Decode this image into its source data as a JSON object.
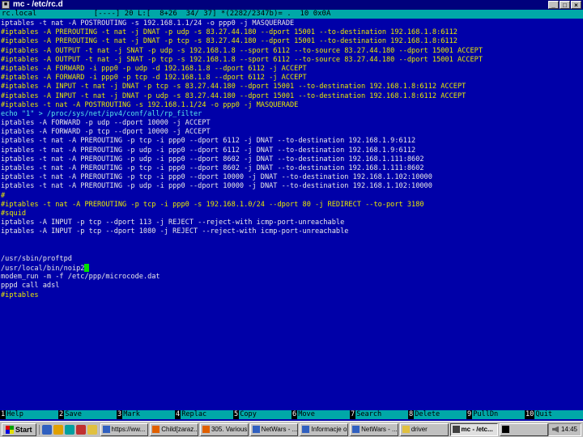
{
  "window": {
    "title": "mc - /etc/rc.d",
    "controls": [
      "_",
      "□",
      "×"
    ]
  },
  "status_line": "rc.local             [----] 20 L:[  8+26  34/ 37] *(2282/2347b)= .  10 0x0A",
  "editor": {
    "lines": [
      {
        "text": "iptables -t nat -A POSTROUTING -s 192.168.1.1/24 -o ppp0 -j MASQUERADE",
        "color": "white"
      },
      {
        "text": "#iptables -A PREROUTING -t nat -j DNAT -p udp -s 83.27.44.180 --dport 15001 --to-destination 192.168.1.8:6112",
        "color": "yellow"
      },
      {
        "text": "#iptables -A PREROUTING -t nat -j DNAT -p tcp -s 83.27.44.180 --dport 15001 --to-destination 192.168.1.8:6112",
        "color": "yellow"
      },
      {
        "text": "#iptables -A OUTPUT -t nat -j SNAT -p udp -s 192.168.1.8 --sport 6112 --to-source 83.27.44.180 --dport 15001 ACCEPT",
        "color": "yellow"
      },
      {
        "text": "#iptables -A OUTPUT -t nat -j SNAT -p tcp -s 192.168.1.8 --sport 6112 --to-source 83.27.44.180 --dport 15001 ACCEPT",
        "color": "yellow"
      },
      {
        "text": "#iptables -A FORWARD -i ppp0 -p udp -d 192.168.1.8 --dport 6112 -j ACCEPT",
        "color": "yellow"
      },
      {
        "text": "#iptables -A FORWARD -i ppp0 -p tcp -d 192.168.1.8 --dport 6112 -j ACCEPT",
        "color": "yellow"
      },
      {
        "text": "#iptables -A INPUT -t nat -j DNAT -p tcp -s 83.27.44.180 --dport 15001 --to-destination 192.168.1.8:6112 ACCEPT",
        "color": "yellow"
      },
      {
        "text": "#iptables -A INPUT -t nat -j DNAT -p udp -s 83.27.44.180 --dport 15001 --to-destination 192.168.1.8:6112 ACCEPT",
        "color": "yellow"
      },
      {
        "text": "#iptables -t nat -A POSTROUTING -s 192.168.1.1/24 -o ppp0 -j MASQUERADE",
        "color": "yellow"
      },
      {
        "text": "echo \"1\" > /proc/sys/net/ipv4/conf/all/rp_filter",
        "color": "cyan"
      },
      {
        "text": "iptables -A FORWARD -p udp --dport 10000 -j ACCEPT",
        "color": "white"
      },
      {
        "text": "iptables -A FORWARD -p tcp --dport 10000 -j ACCEPT",
        "color": "white"
      },
      {
        "text": "iptables -t nat -A PREROUTING -p tcp -i ppp0 --dport 6112 -j DNAT --to-destination 192.168.1.9:6112",
        "color": "white"
      },
      {
        "text": "iptables -t nat -A PREROUTING -p udp -i ppp0 --dport 6112 -j DNAT --to-destination 192.168.1.9:6112",
        "color": "white"
      },
      {
        "text": "iptables -t nat -A PREROUTING -p udp -i ppp0 --dport 8602 -j DNAT --to-destination 192.168.1.111:8602",
        "color": "white"
      },
      {
        "text": "iptables -t nat -A PREROUTING -p tcp -i ppp0 --dport 8602 -j DNAT --to-destination 192.168.1.111:8602",
        "color": "white"
      },
      {
        "text": "iptables -t nat -A PREROUTING -p tcp -i ppp0 --dport 10000 -j DNAT --to-destination 192.168.1.102:10000",
        "color": "white"
      },
      {
        "text": "iptables -t nat -A PREROUTING -p udp -i ppp0 --dport 10000 -j DNAT --to-destination 192.168.1.102:10000",
        "color": "white"
      },
      {
        "text": "#",
        "color": "yellow"
      },
      {
        "text": "#iptables -t nat -A PREROUTING -p tcp -i ppp0 -s 192.168.1.0/24 --dport 80 -j REDIRECT --to-port 3180",
        "color": "yellow"
      },
      {
        "text": "#squid",
        "color": "yellow"
      },
      {
        "text": "iptables -A INPUT -p tcp --dport 113 -j REJECT --reject-with icmp-port-unreachable",
        "color": "white"
      },
      {
        "text": "iptables -A INPUT -p tcp --dport 1080 -j REJECT --reject-with icmp-port-unreachable",
        "color": "white"
      },
      {
        "text": "",
        "color": "white"
      },
      {
        "text": "",
        "color": "white"
      },
      {
        "text": "/usr/sbin/proftpd",
        "color": "white"
      },
      {
        "text": "/usr/local/bin/noip2",
        "color": "white",
        "cursor": true
      },
      {
        "text": "modem_run -m -f /etc/ppp/microcode.dat",
        "color": "white"
      },
      {
        "text": "pppd call adsl",
        "color": "white"
      },
      {
        "text": "#iptables",
        "color": "yellow"
      }
    ]
  },
  "function_keys": [
    {
      "num": "1",
      "label": "Help"
    },
    {
      "num": "2",
      "label": "Save"
    },
    {
      "num": "3",
      "label": "Mark"
    },
    {
      "num": "4",
      "label": "Replac"
    },
    {
      "num": "5",
      "label": "Copy"
    },
    {
      "num": "6",
      "label": "Move"
    },
    {
      "num": "7",
      "label": "Search"
    },
    {
      "num": "8",
      "label": "Delete"
    },
    {
      "num": "9",
      "label": "PullDn"
    },
    {
      "num": "10",
      "label": "Quit"
    }
  ],
  "taskbar": {
    "start_label": "Start",
    "quick_launch": [
      {
        "name": "browser",
        "color": "#3060c0"
      },
      {
        "name": "mail",
        "color": "#e0a000"
      },
      {
        "name": "desktop",
        "color": "#00a0a0"
      },
      {
        "name": "media",
        "color": "#c03030"
      },
      {
        "name": "explorer",
        "color": "#e0c040"
      }
    ],
    "tasks": [
      {
        "label": "https://ww...",
        "icon_color": "#3060c0",
        "active": false
      },
      {
        "label": "Child[zaraz...",
        "icon_color": "#e06000",
        "active": false
      },
      {
        "label": "305. Various...",
        "icon_color": "#e06000",
        "active": false
      },
      {
        "label": "NetWars - ...",
        "icon_color": "#3060c0",
        "active": false
      },
      {
        "label": "Informacje o...",
        "icon_color": "#3060c0",
        "active": false
      },
      {
        "label": "NetWars - ...",
        "icon_color": "#3060c0",
        "active": false
      },
      {
        "label": "driver",
        "icon_color": "#e0c040",
        "active": false
      },
      {
        "label": "mc - /etc...",
        "icon_color": "#404040",
        "active": true
      },
      {
        "label": "",
        "icon_color": "#000000",
        "active": false
      }
    ],
    "clock": "14:45"
  }
}
